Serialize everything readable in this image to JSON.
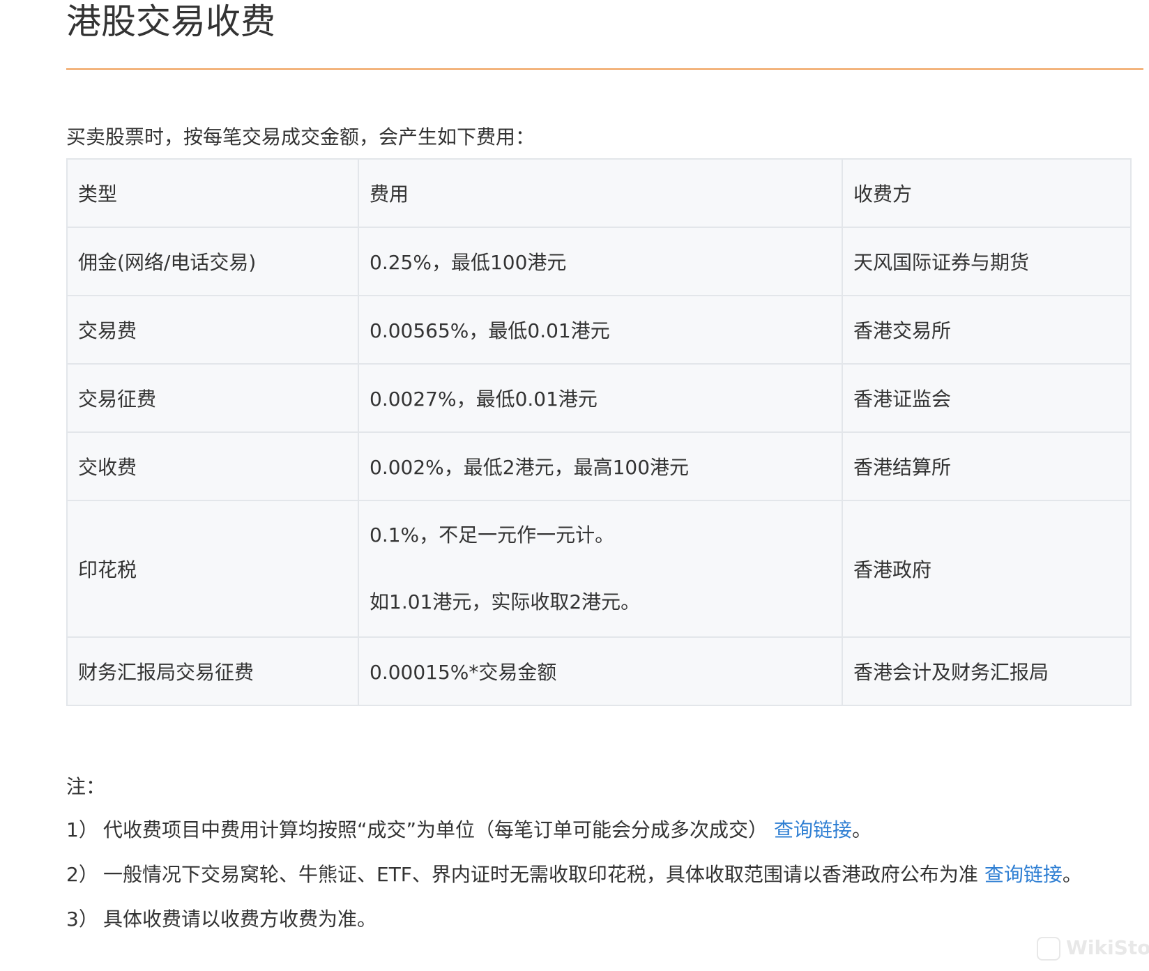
{
  "page": {
    "title": "港股交易收费",
    "intro": "买卖股票时，按每笔交易成交金额，会产生如下费用："
  },
  "table": {
    "headers": [
      "类型",
      "费用",
      "收费方"
    ],
    "rows": [
      {
        "type": "佣金(网络/电话交易)",
        "fee": "0.25%，最低100港元",
        "collector": "天风国际证券与期货"
      },
      {
        "type": "交易费",
        "fee": "0.00565%，最低0.01港元",
        "collector": "香港交易所"
      },
      {
        "type": "交易征费",
        "fee": "0.0027%，最低0.01港元",
        "collector": "香港证监会"
      },
      {
        "type": "交收费",
        "fee": "0.002%，最低2港元，最高100港元",
        "collector": "香港结算所"
      },
      {
        "type": "印花税",
        "fee_lines": [
          "0.1%，不足一元作一元计。",
          "如1.01港元，实际收取2港元。"
        ],
        "collector": "香港政府"
      },
      {
        "type": "财务汇报局交易征费",
        "fee": "0.00015%*交易金额",
        "collector": "香港会计及财务汇报局"
      }
    ]
  },
  "notes": {
    "label": "注：",
    "items": [
      {
        "num": "1）",
        "text": "代收费项目中费用计算均按照“成交”为单位（每笔订单可能会分成多次成交）",
        "link": "查询链接",
        "end": "。"
      },
      {
        "num": "2）",
        "text": "一般情况下交易窝轮、牛熊证、ETF、界内证时无需收取印花税，具体收取范围请以香港政府公布为准",
        "link": "查询链接",
        "end": "。"
      },
      {
        "num": "3）",
        "text": "具体收费请以收费方收费为准。"
      }
    ]
  },
  "watermark": {
    "text": "WikiStock",
    "icon": "wikistock-logo-icon"
  },
  "colors": {
    "divider": "#f0a05a",
    "link": "#2f7fd3",
    "table_bg": "#f7f8fa",
    "table_border": "#e3e6ea"
  }
}
